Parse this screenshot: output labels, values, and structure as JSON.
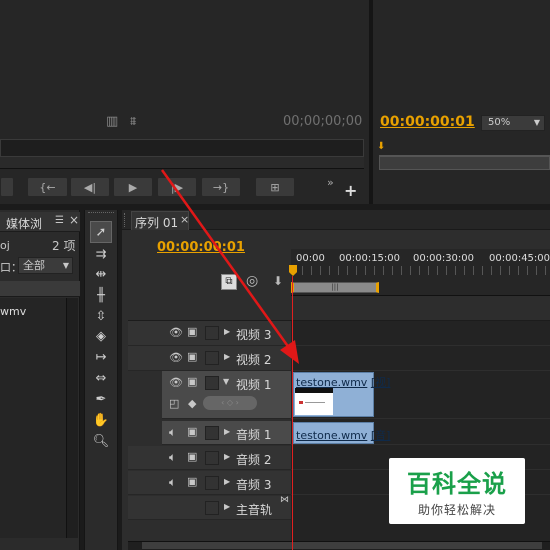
{
  "source_monitor": {
    "timecode": "00;00;00;00"
  },
  "program_monitor": {
    "timecode": "00:00:00:01",
    "zoom": "50%"
  },
  "project_panel": {
    "tab_label": "媒体浏",
    "project_name": "oj",
    "item_count": "2 项",
    "entry_label": "口：",
    "entry_value": "全部",
    "list_item": "wmv"
  },
  "sequence": {
    "tab_label": "序列 01",
    "close_glyph": "×",
    "timecode": "00:00:00:01",
    "ruler_ticks": [
      "00:00",
      "00:00:15:00",
      "00:00:30:00",
      "00:00:45:00"
    ]
  },
  "tracks": {
    "video3": "视频 3",
    "video2": "视频 2",
    "video1": "视频 1",
    "audio1": "音频 1",
    "audio2": "音频 2",
    "audio3": "音频 3",
    "master": "主音轨"
  },
  "clips": {
    "video_clip": "testone.wmv",
    "video_clip_suffix": "[视]",
    "audio_clip": "testone.wmv",
    "audio_clip_suffix": "[音]"
  },
  "watermark": {
    "title": "百科全说",
    "subtitle": "助你轻松解决"
  },
  "colors": {
    "timecode": "#e8a100",
    "playhead": "#e02020",
    "clip": "#8fb0d6",
    "arrow": "#e01818"
  }
}
